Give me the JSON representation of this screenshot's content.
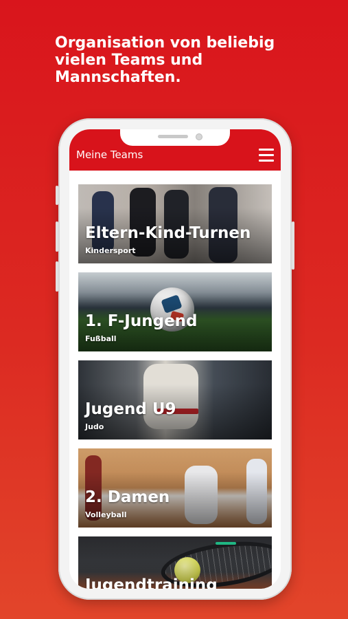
{
  "promo": {
    "headline": "Organisation von beliebig vielen Teams und Mannschaften."
  },
  "app": {
    "title": "Meine Teams",
    "menu_icon": "hamburger-menu-icon",
    "accent_color": "#d8131b"
  },
  "teams": [
    {
      "name": "Eltern-Kind-Turnen",
      "sport": "Kindersport"
    },
    {
      "name": "1. F-Jungend",
      "sport": "Fußball"
    },
    {
      "name": "Jugend U9",
      "sport": "Judo"
    },
    {
      "name": "2. Damen",
      "sport": "Volleyball"
    },
    {
      "name": "Jugendtraining",
      "sport": ""
    }
  ]
}
